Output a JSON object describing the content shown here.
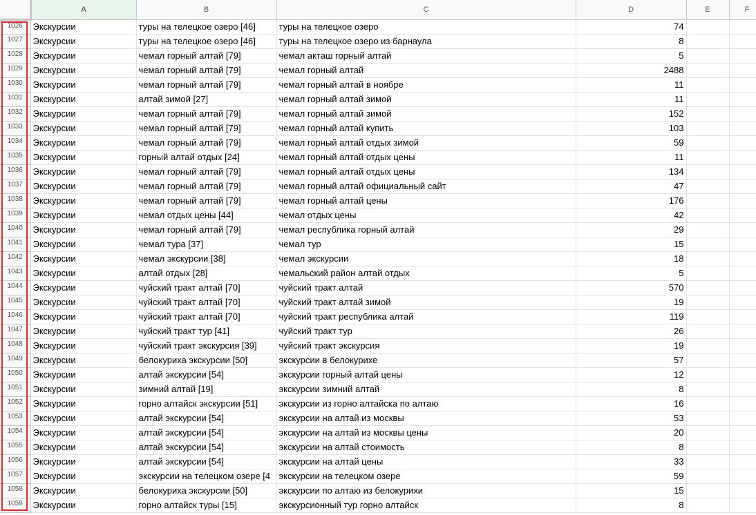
{
  "columns": [
    "A",
    "B",
    "C",
    "D",
    "E",
    "F"
  ],
  "highlight_color": "#e3262c",
  "rows": [
    {
      "num": "1026",
      "a": "Экскурсии",
      "b": "туры на телецкое озеро [46]",
      "c": "туры на телецкое озеро",
      "d": "74"
    },
    {
      "num": "1027",
      "a": "Экскурсии",
      "b": "туры на телецкое озеро [46]",
      "c": "туры на телецкое озеро из барнаула",
      "d": "8"
    },
    {
      "num": "1028",
      "a": "Экскурсии",
      "b": "чемал горный алтай [79]",
      "c": "чемал акташ горный алтай",
      "d": "5"
    },
    {
      "num": "1029",
      "a": "Экскурсии",
      "b": "чемал горный алтай [79]",
      "c": "чемал горный алтай",
      "d": "2488"
    },
    {
      "num": "1030",
      "a": "Экскурсии",
      "b": "чемал горный алтай [79]",
      "c": "чемал горный алтай в ноябре",
      "d": "11"
    },
    {
      "num": "1031",
      "a": "Экскурсии",
      "b": "алтай зимой [27]",
      "c": "чемал горный алтай зимой",
      "d": "11"
    },
    {
      "num": "1032",
      "a": "Экскурсии",
      "b": "чемал горный алтай [79]",
      "c": "чемал горный алтай зимой",
      "d": "152"
    },
    {
      "num": "1033",
      "a": "Экскурсии",
      "b": "чемал горный алтай [79]",
      "c": "чемал горный алтай купить",
      "d": "103"
    },
    {
      "num": "1034",
      "a": "Экскурсии",
      "b": "чемал горный алтай [79]",
      "c": "чемал горный алтай отдых зимой",
      "d": "59"
    },
    {
      "num": "1035",
      "a": "Экскурсии",
      "b": "горный алтай отдых [24]",
      "c": "чемал горный алтай отдых цены",
      "d": "11"
    },
    {
      "num": "1036",
      "a": "Экскурсии",
      "b": "чемал горный алтай [79]",
      "c": "чемал горный алтай отдых цены",
      "d": "134"
    },
    {
      "num": "1037",
      "a": "Экскурсии",
      "b": "чемал горный алтай [79]",
      "c": "чемал горный алтай официальный сайт",
      "d": "47"
    },
    {
      "num": "1038",
      "a": "Экскурсии",
      "b": "чемал горный алтай [79]",
      "c": "чемал горный алтай цены",
      "d": "176"
    },
    {
      "num": "1039",
      "a": "Экскурсии",
      "b": "чемал отдых цены [44]",
      "c": "чемал отдых цены",
      "d": "42"
    },
    {
      "num": "1040",
      "a": "Экскурсии",
      "b": "чемал горный алтай [79]",
      "c": "чемал республика горный алтай",
      "d": "29"
    },
    {
      "num": "1041",
      "a": "Экскурсии",
      "b": "чемал тура [37]",
      "c": "чемал тур",
      "d": "15"
    },
    {
      "num": "1042",
      "a": "Экскурсии",
      "b": "чемал экскурсии [38]",
      "c": "чемал экскурсии",
      "d": "18"
    },
    {
      "num": "1043",
      "a": "Экскурсии",
      "b": "алтай отдых [28]",
      "c": "чемальский район алтай отдых",
      "d": "5"
    },
    {
      "num": "1044",
      "a": "Экскурсии",
      "b": "чуйский тракт алтай [70]",
      "c": "чуйский тракт алтай",
      "d": "570"
    },
    {
      "num": "1045",
      "a": "Экскурсии",
      "b": "чуйский тракт алтай [70]",
      "c": "чуйский тракт алтай зимой",
      "d": "19"
    },
    {
      "num": "1046",
      "a": "Экскурсии",
      "b": "чуйский тракт алтай [70]",
      "c": "чуйский тракт республика алтай",
      "d": "119"
    },
    {
      "num": "1047",
      "a": "Экскурсии",
      "b": "чуйский тракт тур [41]",
      "c": "чуйский тракт тур",
      "d": "26"
    },
    {
      "num": "1048",
      "a": "Экскурсии",
      "b": "чуйский тракт экскурсия [39]",
      "c": "чуйский тракт экскурсия",
      "d": "19"
    },
    {
      "num": "1049",
      "a": "Экскурсии",
      "b": "белокуриха экскурсии [50]",
      "c": "экскурсии в белокурихе",
      "d": "57"
    },
    {
      "num": "1050",
      "a": "Экскурсии",
      "b": "алтай экскурсии [54]",
      "c": "экскурсии горный алтай цены",
      "d": "12"
    },
    {
      "num": "1051",
      "a": "Экскурсии",
      "b": "зимний алтай [19]",
      "c": "экскурсии зимний алтай",
      "d": "8"
    },
    {
      "num": "1052",
      "a": "Экскурсии",
      "b": "горно алтайск экскурсии [51]",
      "c": "экскурсии из горно алтайска по алтаю",
      "d": "16"
    },
    {
      "num": "1053",
      "a": "Экскурсии",
      "b": "алтай экскурсии [54]",
      "c": "экскурсии на алтай из москвы",
      "d": "53"
    },
    {
      "num": "1054",
      "a": "Экскурсии",
      "b": "алтай экскурсии [54]",
      "c": "экскурсии на алтай из москвы цены",
      "d": "20"
    },
    {
      "num": "1055",
      "a": "Экскурсии",
      "b": "алтай экскурсии [54]",
      "c": "экскурсии на алтай стоимость",
      "d": "8"
    },
    {
      "num": "1056",
      "a": "Экскурсии",
      "b": "алтай экскурсии [54]",
      "c": "экскурсии на алтай цены",
      "d": "33"
    },
    {
      "num": "1057",
      "a": "Экскурсии",
      "b": "экскурсии на телецком озере [4",
      "c": "экскурсии на телецком озере",
      "d": "59"
    },
    {
      "num": "1058",
      "a": "Экскурсии",
      "b": "белокуриха экскурсии [50]",
      "c": "экскурсии по алтаю из белокурихи",
      "d": "15"
    },
    {
      "num": "1059",
      "a": "Экскурсии",
      "b": "горно алтайск туры [15]",
      "c": "экскурсионный тур горно алтайск",
      "d": "8"
    }
  ]
}
